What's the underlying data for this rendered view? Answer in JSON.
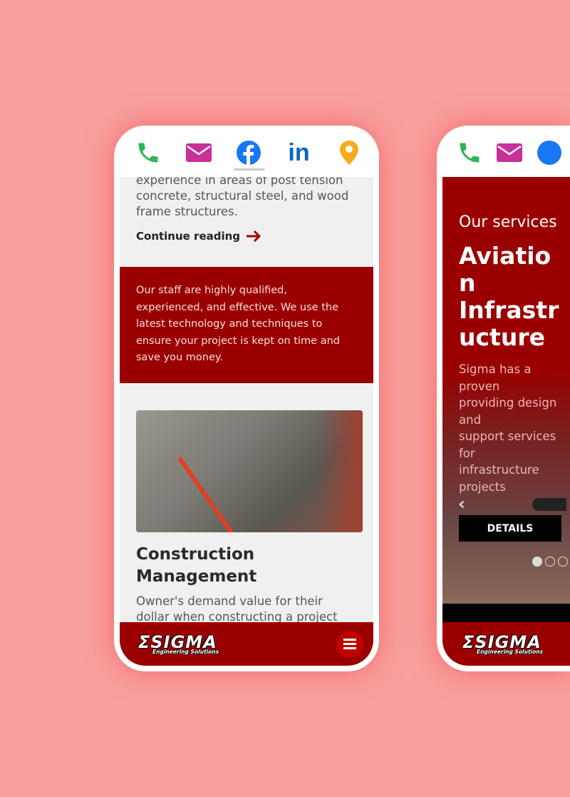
{
  "phone1": {
    "icons": [
      "phone-icon",
      "mail-icon",
      "facebook-icon",
      "linkedin-icon",
      "location-pin-icon"
    ],
    "intro_lines": [
      "experience in areas of post tension",
      "concrete, structural steel, and wood",
      "frame structures."
    ],
    "continue_label": "Continue reading",
    "staff_text": "Our staff are highly qualified, experienced, and effective. We use the latest technology and techniques to ensure your project is kept on time and save you money.",
    "card_title": "Construction Management",
    "card_text": "Owner's demand value for their dollar when constructing a project"
  },
  "phone2": {
    "eyebrow": "Our services",
    "title_lines": [
      "Aviation",
      "Infrastructure"
    ],
    "body_lines": [
      "Sigma has a proven",
      "providing design and",
      "support services for",
      "infrastructure projects"
    ],
    "details_label": "DETAILS"
  },
  "logo": {
    "main": "ΣSIGMA",
    "sub": "Engineering Solutions"
  },
  "colors": {
    "brand_red": "#9b0000",
    "background": "#f8a09e",
    "phone": "#2fb457",
    "mail": "#c8309a",
    "facebook": "#1877f2",
    "linkedin": "#0a66c2",
    "location": "#f5ab1c"
  }
}
